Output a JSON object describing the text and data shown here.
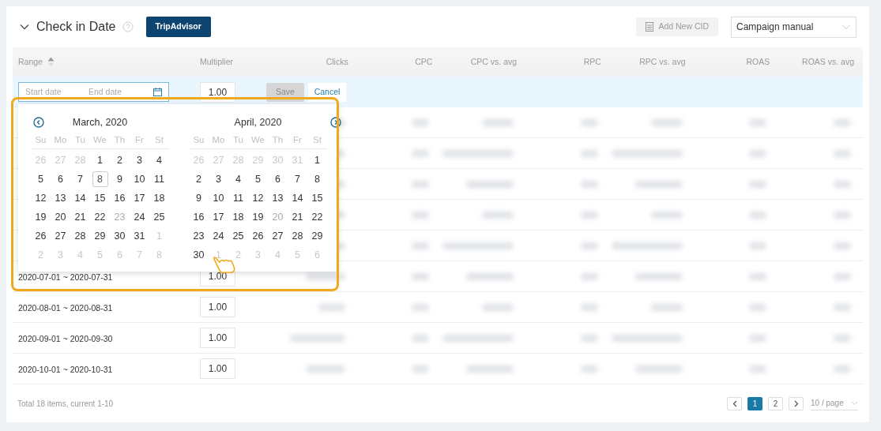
{
  "header": {
    "title": "Check in Date",
    "expanded": true,
    "badge": "TripAdvisor",
    "add_button": {
      "label": "Add New CID",
      "disabled": true
    },
    "select": {
      "value": "Campaign manual"
    }
  },
  "table": {
    "columns": [
      "Range",
      "Multiplier",
      "Clicks",
      "CPC",
      "CPC vs. avg",
      "RPC",
      "RPC vs. avg",
      "ROAS",
      "ROAS vs. avg"
    ],
    "edit_row": {
      "start_placeholder": "Start date",
      "end_placeholder": "End date",
      "multiplier": "1.00",
      "save": {
        "label": "Save",
        "disabled": true
      },
      "cancel": "Cancel"
    },
    "rows": [
      {
        "kind": "covered"
      },
      {
        "kind": "covered"
      },
      {
        "kind": "covered"
      },
      {
        "kind": "covered"
      },
      {
        "kind": "covered"
      },
      {
        "kind": "data",
        "range": "2020-07-01 ~ 2020-07-31",
        "multiplier": "1.00"
      },
      {
        "kind": "data",
        "range": "2020-08-01 ~ 2020-08-31",
        "multiplier": "1.00"
      },
      {
        "kind": "data",
        "range": "2020-09-01 ~ 2020-09-30",
        "multiplier": "1.00"
      },
      {
        "kind": "data",
        "range": "2020-10-01 ~ 2020-10-31",
        "multiplier": "1.00"
      }
    ]
  },
  "datepicker": {
    "months": [
      {
        "title": "March, 2020",
        "weekdays": [
          "Su",
          "Mo",
          "Tu",
          "We",
          "Th",
          "Fr",
          "St"
        ],
        "weeks": [
          [
            {
              "text": "26",
              "kind": "other"
            },
            {
              "text": "27",
              "kind": "other"
            },
            {
              "text": "28",
              "kind": "other"
            },
            {
              "text": "1",
              "kind": "day"
            },
            {
              "text": "2",
              "kind": "day"
            },
            {
              "text": "3",
              "kind": "day"
            },
            {
              "text": "4",
              "kind": "day"
            }
          ],
          [
            {
              "text": "5",
              "kind": "day"
            },
            {
              "text": "6",
              "kind": "day"
            },
            {
              "text": "7",
              "kind": "day"
            },
            {
              "text": "8",
              "kind": "today"
            },
            {
              "text": "9",
              "kind": "day"
            },
            {
              "text": "10",
              "kind": "day"
            },
            {
              "text": "11",
              "kind": "day"
            }
          ],
          [
            {
              "text": "12",
              "kind": "day"
            },
            {
              "text": "13",
              "kind": "day"
            },
            {
              "text": "14",
              "kind": "day"
            },
            {
              "text": "15",
              "kind": "day"
            },
            {
              "text": "16",
              "kind": "day"
            },
            {
              "text": "17",
              "kind": "day"
            },
            {
              "text": "18",
              "kind": "day"
            }
          ],
          [
            {
              "text": "19",
              "kind": "day"
            },
            {
              "text": "20",
              "kind": "day"
            },
            {
              "text": "21",
              "kind": "day"
            },
            {
              "text": "22",
              "kind": "day"
            },
            {
              "text": "23",
              "kind": "disabled"
            },
            {
              "text": "24",
              "kind": "day"
            },
            {
              "text": "25",
              "kind": "day"
            }
          ],
          [
            {
              "text": "26",
              "kind": "day"
            },
            {
              "text": "27",
              "kind": "day"
            },
            {
              "text": "28",
              "kind": "day"
            },
            {
              "text": "29",
              "kind": "day"
            },
            {
              "text": "30",
              "kind": "day"
            },
            {
              "text": "31",
              "kind": "day"
            },
            {
              "text": "1",
              "kind": "other"
            }
          ],
          [
            {
              "text": "2",
              "kind": "other"
            },
            {
              "text": "3",
              "kind": "other"
            },
            {
              "text": "4",
              "kind": "other"
            },
            {
              "text": "5",
              "kind": "other"
            },
            {
              "text": "6",
              "kind": "other"
            },
            {
              "text": "7",
              "kind": "other"
            },
            {
              "text": "8",
              "kind": "other"
            }
          ]
        ]
      },
      {
        "title": "April, 2020",
        "weekdays": [
          "Su",
          "Mo",
          "Tu",
          "We",
          "Th",
          "Fr",
          "St"
        ],
        "weeks": [
          [
            {
              "text": "26",
              "kind": "other"
            },
            {
              "text": "27",
              "kind": "other"
            },
            {
              "text": "28",
              "kind": "other"
            },
            {
              "text": "29",
              "kind": "other"
            },
            {
              "text": "30",
              "kind": "other"
            },
            {
              "text": "31",
              "kind": "other"
            },
            {
              "text": "1",
              "kind": "day"
            }
          ],
          [
            {
              "text": "2",
              "kind": "day"
            },
            {
              "text": "3",
              "kind": "day"
            },
            {
              "text": "4",
              "kind": "day"
            },
            {
              "text": "5",
              "kind": "day"
            },
            {
              "text": "6",
              "kind": "day"
            },
            {
              "text": "7",
              "kind": "day"
            },
            {
              "text": "8",
              "kind": "day"
            }
          ],
          [
            {
              "text": "9",
              "kind": "day"
            },
            {
              "text": "10",
              "kind": "day"
            },
            {
              "text": "11",
              "kind": "day"
            },
            {
              "text": "12",
              "kind": "day"
            },
            {
              "text": "13",
              "kind": "day"
            },
            {
              "text": "14",
              "kind": "day"
            },
            {
              "text": "15",
              "kind": "day"
            }
          ],
          [
            {
              "text": "16",
              "kind": "day"
            },
            {
              "text": "17",
              "kind": "day"
            },
            {
              "text": "18",
              "kind": "day"
            },
            {
              "text": "19",
              "kind": "day"
            },
            {
              "text": "20",
              "kind": "disabled"
            },
            {
              "text": "21",
              "kind": "day"
            },
            {
              "text": "22",
              "kind": "day"
            }
          ],
          [
            {
              "text": "23",
              "kind": "day"
            },
            {
              "text": "24",
              "kind": "day"
            },
            {
              "text": "25",
              "kind": "day"
            },
            {
              "text": "26",
              "kind": "day"
            },
            {
              "text": "27",
              "kind": "day"
            },
            {
              "text": "28",
              "kind": "day"
            },
            {
              "text": "29",
              "kind": "day"
            }
          ],
          [
            {
              "text": "30",
              "kind": "day"
            },
            {
              "text": "1",
              "kind": "other"
            },
            {
              "text": "2",
              "kind": "other"
            },
            {
              "text": "3",
              "kind": "other"
            },
            {
              "text": "4",
              "kind": "other"
            },
            {
              "text": "5",
              "kind": "other"
            },
            {
              "text": "6",
              "kind": "other"
            }
          ]
        ]
      }
    ]
  },
  "footer": {
    "summary": "Total 18 items, current 1-10",
    "pages": [
      {
        "label": "1",
        "selected": true
      },
      {
        "label": "2",
        "selected": false
      }
    ],
    "page_size": "10 / page"
  }
}
